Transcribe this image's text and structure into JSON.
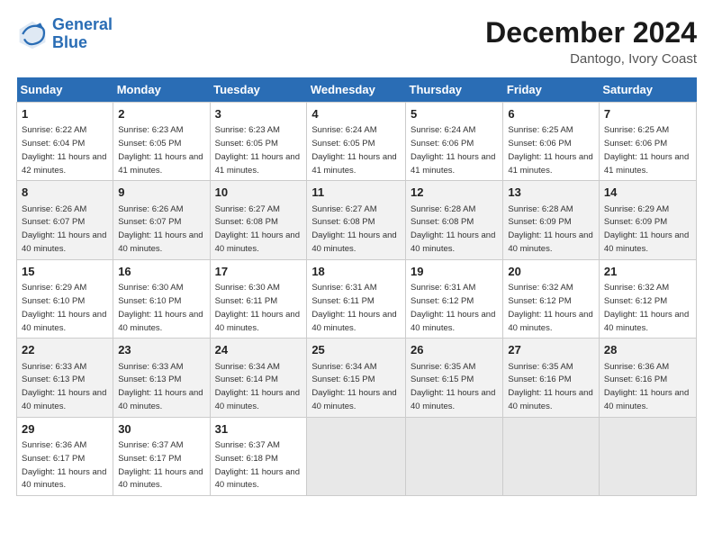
{
  "logo": {
    "line1": "General",
    "line2": "Blue"
  },
  "title": "December 2024",
  "location": "Dantogo, Ivory Coast",
  "days_of_week": [
    "Sunday",
    "Monday",
    "Tuesday",
    "Wednesday",
    "Thursday",
    "Friday",
    "Saturday"
  ],
  "weeks": [
    [
      {
        "day": "1",
        "sunrise": "6:22 AM",
        "sunset": "6:04 PM",
        "daylight": "11 hours and 42 minutes."
      },
      {
        "day": "2",
        "sunrise": "6:23 AM",
        "sunset": "6:05 PM",
        "daylight": "11 hours and 41 minutes."
      },
      {
        "day": "3",
        "sunrise": "6:23 AM",
        "sunset": "6:05 PM",
        "daylight": "11 hours and 41 minutes."
      },
      {
        "day": "4",
        "sunrise": "6:24 AM",
        "sunset": "6:05 PM",
        "daylight": "11 hours and 41 minutes."
      },
      {
        "day": "5",
        "sunrise": "6:24 AM",
        "sunset": "6:06 PM",
        "daylight": "11 hours and 41 minutes."
      },
      {
        "day": "6",
        "sunrise": "6:25 AM",
        "sunset": "6:06 PM",
        "daylight": "11 hours and 41 minutes."
      },
      {
        "day": "7",
        "sunrise": "6:25 AM",
        "sunset": "6:06 PM",
        "daylight": "11 hours and 41 minutes."
      }
    ],
    [
      {
        "day": "8",
        "sunrise": "6:26 AM",
        "sunset": "6:07 PM",
        "daylight": "11 hours and 40 minutes."
      },
      {
        "day": "9",
        "sunrise": "6:26 AM",
        "sunset": "6:07 PM",
        "daylight": "11 hours and 40 minutes."
      },
      {
        "day": "10",
        "sunrise": "6:27 AM",
        "sunset": "6:08 PM",
        "daylight": "11 hours and 40 minutes."
      },
      {
        "day": "11",
        "sunrise": "6:27 AM",
        "sunset": "6:08 PM",
        "daylight": "11 hours and 40 minutes."
      },
      {
        "day": "12",
        "sunrise": "6:28 AM",
        "sunset": "6:08 PM",
        "daylight": "11 hours and 40 minutes."
      },
      {
        "day": "13",
        "sunrise": "6:28 AM",
        "sunset": "6:09 PM",
        "daylight": "11 hours and 40 minutes."
      },
      {
        "day": "14",
        "sunrise": "6:29 AM",
        "sunset": "6:09 PM",
        "daylight": "11 hours and 40 minutes."
      }
    ],
    [
      {
        "day": "15",
        "sunrise": "6:29 AM",
        "sunset": "6:10 PM",
        "daylight": "11 hours and 40 minutes."
      },
      {
        "day": "16",
        "sunrise": "6:30 AM",
        "sunset": "6:10 PM",
        "daylight": "11 hours and 40 minutes."
      },
      {
        "day": "17",
        "sunrise": "6:30 AM",
        "sunset": "6:11 PM",
        "daylight": "11 hours and 40 minutes."
      },
      {
        "day": "18",
        "sunrise": "6:31 AM",
        "sunset": "6:11 PM",
        "daylight": "11 hours and 40 minutes."
      },
      {
        "day": "19",
        "sunrise": "6:31 AM",
        "sunset": "6:12 PM",
        "daylight": "11 hours and 40 minutes."
      },
      {
        "day": "20",
        "sunrise": "6:32 AM",
        "sunset": "6:12 PM",
        "daylight": "11 hours and 40 minutes."
      },
      {
        "day": "21",
        "sunrise": "6:32 AM",
        "sunset": "6:12 PM",
        "daylight": "11 hours and 40 minutes."
      }
    ],
    [
      {
        "day": "22",
        "sunrise": "6:33 AM",
        "sunset": "6:13 PM",
        "daylight": "11 hours and 40 minutes."
      },
      {
        "day": "23",
        "sunrise": "6:33 AM",
        "sunset": "6:13 PM",
        "daylight": "11 hours and 40 minutes."
      },
      {
        "day": "24",
        "sunrise": "6:34 AM",
        "sunset": "6:14 PM",
        "daylight": "11 hours and 40 minutes."
      },
      {
        "day": "25",
        "sunrise": "6:34 AM",
        "sunset": "6:15 PM",
        "daylight": "11 hours and 40 minutes."
      },
      {
        "day": "26",
        "sunrise": "6:35 AM",
        "sunset": "6:15 PM",
        "daylight": "11 hours and 40 minutes."
      },
      {
        "day": "27",
        "sunrise": "6:35 AM",
        "sunset": "6:16 PM",
        "daylight": "11 hours and 40 minutes."
      },
      {
        "day": "28",
        "sunrise": "6:36 AM",
        "sunset": "6:16 PM",
        "daylight": "11 hours and 40 minutes."
      }
    ],
    [
      {
        "day": "29",
        "sunrise": "6:36 AM",
        "sunset": "6:17 PM",
        "daylight": "11 hours and 40 minutes."
      },
      {
        "day": "30",
        "sunrise": "6:37 AM",
        "sunset": "6:17 PM",
        "daylight": "11 hours and 40 minutes."
      },
      {
        "day": "31",
        "sunrise": "6:37 AM",
        "sunset": "6:18 PM",
        "daylight": "11 hours and 40 minutes."
      },
      null,
      null,
      null,
      null
    ]
  ]
}
